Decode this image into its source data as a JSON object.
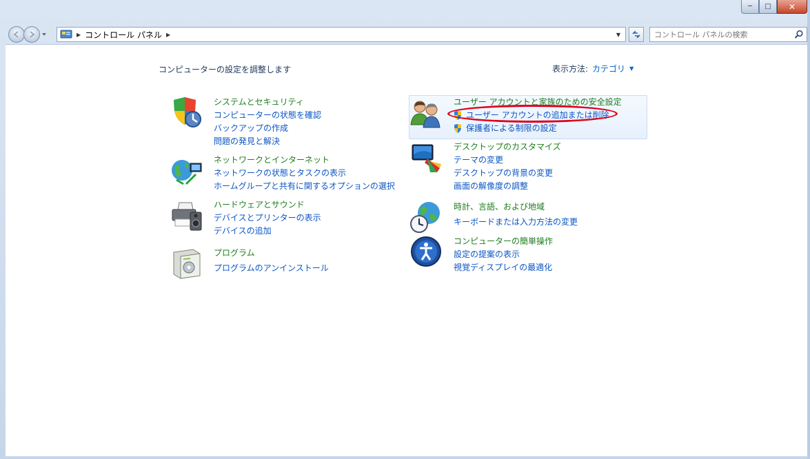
{
  "address": {
    "crumbs": [
      "コントロール パネル"
    ]
  },
  "search": {
    "placeholder": "コントロール パネルの検索"
  },
  "page": {
    "title": "コンピューターの設定を調整します",
    "view_by_label": "表示方法:",
    "view_by_value": "カテゴリ"
  },
  "categories": [
    {
      "head": "システムとセキュリティ",
      "links": [
        "コンピューターの状態を確認",
        "バックアップの作成",
        "問題の発見と解決"
      ],
      "icon": "shield-icon"
    },
    {
      "head": "ネットワークとインターネット",
      "links": [
        "ネットワークの状態とタスクの表示",
        "ホームグループと共有に関するオプションの選択"
      ],
      "icon": "network-globe-icon"
    },
    {
      "head": "ハードウェアとサウンド",
      "links": [
        "デバイスとプリンターの表示",
        "デバイスの追加"
      ],
      "icon": "printer-speaker-icon"
    },
    {
      "head": "プログラム",
      "links": [
        "プログラムのアンインストール"
      ],
      "icon": "programs-box-icon"
    },
    {
      "head": "ユーザー アカウントと家族のための安全設定",
      "links": [
        "ユーザー アカウントの追加または削除",
        "保護者による制限の設定"
      ],
      "icon": "users-icon"
    },
    {
      "head": "デスクトップのカスタマイズ",
      "links": [
        "テーマの変更",
        "デスクトップの背景の変更",
        "画面の解像度の調整"
      ],
      "icon": "monitor-palette-icon"
    },
    {
      "head": "時計、言語、および地域",
      "links": [
        "キーボードまたは入力方法の変更"
      ],
      "icon": "globe-clock-icon"
    },
    {
      "head": "コンピューターの簡単操作",
      "links": [
        "設定の提案の表示",
        "視覚ディスプレイの最適化"
      ],
      "icon": "ease-of-access-icon"
    }
  ],
  "colors": {
    "category_head": "#1e7d1e",
    "link": "#0b56c4",
    "highlight_ellipse": "#e0001b"
  }
}
